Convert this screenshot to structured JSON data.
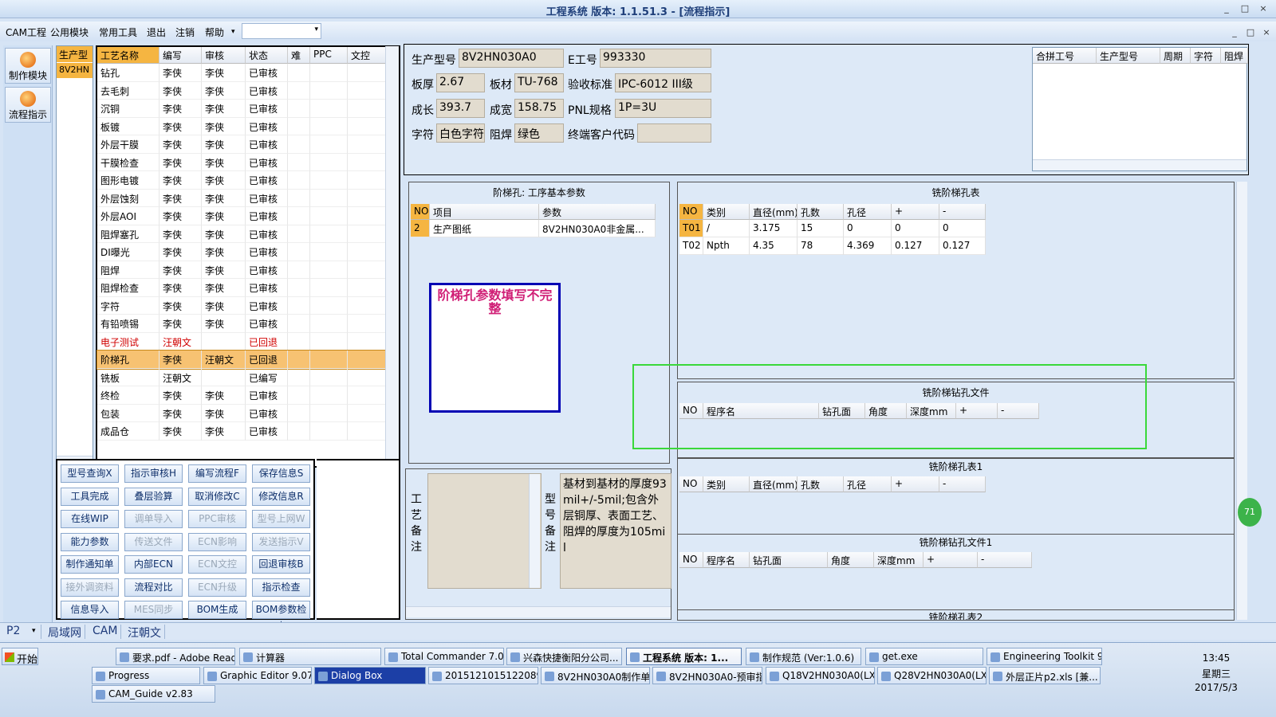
{
  "window": {
    "title": "工程系统  版本: 1.1.51.3 - [流程指示]",
    "min": "_",
    "restore": "□",
    "close": "×"
  },
  "menu": {
    "items": [
      "CAM工程",
      "公用模块",
      "常用工具",
      "退出",
      "注销",
      "帮助"
    ],
    "dropdown_arrow": "▾",
    "combo_value": "",
    "child_min": "_",
    "child_restore": "□",
    "child_close": "×"
  },
  "leftbar": {
    "buttons": [
      {
        "label": "制作模块"
      },
      {
        "label": "流程指示"
      }
    ]
  },
  "product_col": {
    "header": "生产型",
    "row": "8V2HN"
  },
  "process_grid": {
    "columns": [
      "工艺名称",
      "编写",
      "审核",
      "状态",
      "难",
      "PPC",
      "文控"
    ],
    "rows": [
      {
        "name": "钻孔",
        "writer": "李侠",
        "reviewer": "李侠",
        "status": "已审核"
      },
      {
        "name": "去毛刺",
        "writer": "李侠",
        "reviewer": "李侠",
        "status": "已审核"
      },
      {
        "name": "沉铜",
        "writer": "李侠",
        "reviewer": "李侠",
        "status": "已审核"
      },
      {
        "name": "板镀",
        "writer": "李侠",
        "reviewer": "李侠",
        "status": "已审核"
      },
      {
        "name": "外层干膜",
        "writer": "李侠",
        "reviewer": "李侠",
        "status": "已审核"
      },
      {
        "name": "干膜检查",
        "writer": "李侠",
        "reviewer": "李侠",
        "status": "已审核"
      },
      {
        "name": "图形电镀",
        "writer": "李侠",
        "reviewer": "李侠",
        "status": "已审核"
      },
      {
        "name": "外层蚀刻",
        "writer": "李侠",
        "reviewer": "李侠",
        "status": "已审核"
      },
      {
        "name": "外层AOI",
        "writer": "李侠",
        "reviewer": "李侠",
        "status": "已审核"
      },
      {
        "name": "阻焊塞孔",
        "writer": "李侠",
        "reviewer": "李侠",
        "status": "已审核"
      },
      {
        "name": "DI曝光",
        "writer": "李侠",
        "reviewer": "李侠",
        "status": "已审核"
      },
      {
        "name": "阻焊",
        "writer": "李侠",
        "reviewer": "李侠",
        "status": "已审核"
      },
      {
        "name": "阻焊检查",
        "writer": "李侠",
        "reviewer": "李侠",
        "status": "已审核"
      },
      {
        "name": "字符",
        "writer": "李侠",
        "reviewer": "李侠",
        "status": "已审核"
      },
      {
        "name": "有铅喷锡",
        "writer": "李侠",
        "reviewer": "李侠",
        "status": "已审核"
      },
      {
        "name": "电子测试",
        "writer": "汪朝文",
        "reviewer": "",
        "status": "已回退",
        "red": true
      },
      {
        "name": "阶梯孔",
        "writer": "李侠",
        "reviewer": "汪朝文",
        "status": "已回退",
        "selected": true
      },
      {
        "name": "铣板",
        "writer": "汪朝文",
        "reviewer": "",
        "status": "已编写"
      },
      {
        "name": "终检",
        "writer": "李侠",
        "reviewer": "李侠",
        "status": "已审核"
      },
      {
        "name": "包装",
        "writer": "李侠",
        "reviewer": "李侠",
        "status": "已审核"
      },
      {
        "name": "成品仓",
        "writer": "李侠",
        "reviewer": "李侠",
        "status": "已审核"
      }
    ]
  },
  "function_buttons": [
    {
      "label": "型号查询X",
      "enabled": true
    },
    {
      "label": "指示审核H",
      "enabled": true
    },
    {
      "label": "编写流程F",
      "enabled": true
    },
    {
      "label": "保存信息S",
      "enabled": true
    },
    {
      "label": "工具完成",
      "enabled": true
    },
    {
      "label": "叠层验算",
      "enabled": true
    },
    {
      "label": "取消修改C",
      "enabled": true
    },
    {
      "label": "修改信息R",
      "enabled": true
    },
    {
      "label": "在线WIP",
      "enabled": true
    },
    {
      "label": "调单导入",
      "enabled": false
    },
    {
      "label": "PPC审核",
      "enabled": false
    },
    {
      "label": "型号上网W",
      "enabled": false
    },
    {
      "label": "能力参数",
      "enabled": true
    },
    {
      "label": "传送文件",
      "enabled": false
    },
    {
      "label": "ECN影响",
      "enabled": false
    },
    {
      "label": "发送指示V",
      "enabled": false
    },
    {
      "label": "制作通知单",
      "enabled": true
    },
    {
      "label": "内部ECN",
      "enabled": true
    },
    {
      "label": "ECN文控",
      "enabled": false
    },
    {
      "label": "回退审核B",
      "enabled": true
    },
    {
      "label": "接外调资料",
      "enabled": false
    },
    {
      "label": "流程对比",
      "enabled": true
    },
    {
      "label": "ECN升级",
      "enabled": false
    },
    {
      "label": "指示检查",
      "enabled": true
    },
    {
      "label": "信息导入",
      "enabled": true
    },
    {
      "label": "MES同步",
      "enabled": false
    },
    {
      "label": "BOM生成",
      "enabled": true
    },
    {
      "label": "BOM参数检查",
      "enabled": true
    }
  ],
  "info": {
    "prod_model_label": "生产型号",
    "prod_model": "8V2HN030A0",
    "e_no_label": "E工号",
    "e_no": "993330",
    "thickness_label": "板厚",
    "thickness": "2.67",
    "material_label": "板材",
    "material": "TU-768",
    "standard_label": "验收标准",
    "standard": "IPC-6012 III级",
    "length_label": "成长",
    "length": "393.7",
    "width_label": "成宽",
    "width": "158.75",
    "pnl_label": "PNL规格",
    "pnl": "1P=3U",
    "char_label": "字符",
    "char": "白色字符",
    "mask_label": "阻焊",
    "mask": "绿色",
    "customer_label": "终端客户代码",
    "customer": ""
  },
  "merge_grid": {
    "columns": [
      "合拼工号",
      "生产型号",
      "周期",
      "字符",
      "阻焊"
    ]
  },
  "step_params": {
    "title": "阶梯孔: 工序基本参数",
    "columns": [
      "NO",
      "项目",
      "参数"
    ],
    "rows": [
      {
        "no": "2",
        "item": "生产图纸",
        "param": "8V2HN030A0非金属..."
      }
    ]
  },
  "warning": "阶梯孔参数填写不完整",
  "remarks": {
    "process_label": "工艺备注",
    "process_text": "",
    "model_label": "型号备注",
    "model_text": "基材到基材的厚度93mil+/-5mil;包含外层铜厚、表面工艺、阻焊的厚度为105mil"
  },
  "hole_table": {
    "title": "铣阶梯孔表",
    "columns": [
      "NO",
      "类别",
      "直径(mm)",
      "孔数",
      "孔径",
      "+",
      "-"
    ],
    "rows": [
      [
        "T01",
        "/",
        "3.175",
        "15",
        "0",
        "0",
        "0"
      ],
      [
        "T02",
        "Npth",
        "4.35",
        "78",
        "4.369",
        "0.127",
        "0.127"
      ]
    ]
  },
  "drill_file": {
    "title": "铣阶梯钻孔文件",
    "columns": [
      "NO",
      "程序名",
      "钻孔面",
      "角度",
      "深度mm",
      "+",
      "-"
    ]
  },
  "hole_table1": {
    "title": "铣阶梯孔表1",
    "columns": [
      "NO",
      "类别",
      "直径(mm)",
      "孔数",
      "孔径",
      "+",
      "-"
    ]
  },
  "drill_file1": {
    "title": "铣阶梯钻孔文件1",
    "columns": [
      "NO",
      "程序名",
      "钻孔面",
      "角度",
      "深度mm",
      "+",
      "-"
    ]
  },
  "hole_table2": {
    "title": "铣阶梯孔表2"
  },
  "statusbar": {
    "items": [
      "P2",
      "局域网",
      "CAM",
      "汪朝文"
    ],
    "dropdown": "▾"
  },
  "green_badge": "71",
  "taskbar": {
    "start": "开始",
    "row1": [
      "要求.pdf - Adobe Reader",
      "计算器",
      "Total Commander 7.0 p...",
      "兴森快捷衡阳分公司...",
      "工程系统  版本: 1...",
      "制作规范 (Ver:1.0.6)",
      "get.exe",
      "Engineering Toolkit 9.0..."
    ],
    "row2": [
      "Progress",
      "Graphic Editor 9.07b...",
      "Dialog Box",
      "20151210151220890...",
      "8V2HN030A0制作单....",
      "8V2HN030A0-预审指...",
      "Q18V2HN030A0(LXH...",
      "Q28V2HN030A0(LXH...",
      "外层正片p2.xls [兼..."
    ],
    "row3": [
      "CAM_Guide v2.83"
    ],
    "clock": {
      "time": "13:45",
      "weekday": "星期三",
      "date": "2017/5/3"
    }
  }
}
